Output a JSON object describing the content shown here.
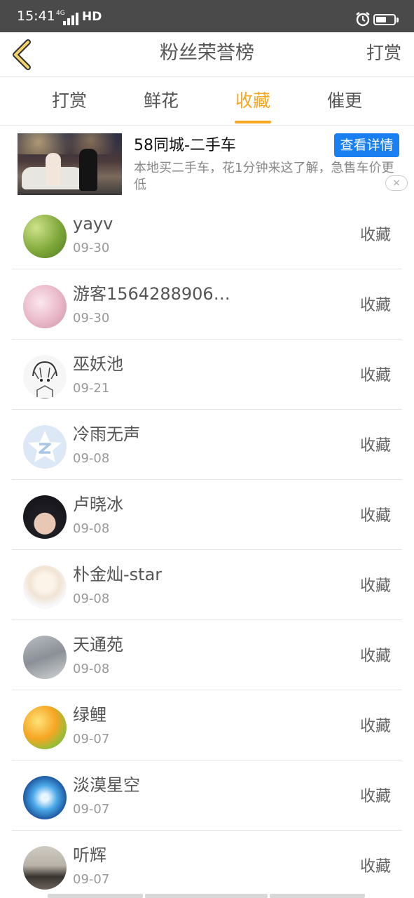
{
  "status_bar": {
    "time": "15:41",
    "network": "4G",
    "hd": "HD",
    "battery_level": 0.6
  },
  "header": {
    "title": "粉丝荣誉榜",
    "right_link": "打赏"
  },
  "tabs": [
    {
      "label": "打赏",
      "active": false
    },
    {
      "label": "鲜花",
      "active": false
    },
    {
      "label": "收藏",
      "active": true
    },
    {
      "label": "催更",
      "active": false
    }
  ],
  "ad": {
    "title": "58同城-二手车",
    "description": "本地买二手车，花1分钟来这了解，急售车价更低",
    "button_label": "查看详情",
    "close_icon": "×"
  },
  "fans": [
    {
      "name": "yayv",
      "date": "09-30",
      "action": "收藏",
      "avatar_icon": "green-leaves-avatar"
    },
    {
      "name": "游客1564288906…",
      "date": "09-30",
      "action": "收藏",
      "avatar_icon": "pink-blossom-avatar"
    },
    {
      "name": "巫妖池",
      "date": "09-21",
      "action": "收藏",
      "avatar_icon": "sketch-anime-avatar"
    },
    {
      "name": "冷雨无声",
      "date": "09-08",
      "action": "收藏",
      "avatar_icon": "default-qq-avatar"
    },
    {
      "name": "卢晓冰",
      "date": "09-08",
      "action": "收藏",
      "avatar_icon": "dark-hair-boy-avatar"
    },
    {
      "name": "朴金灿-star",
      "date": "09-08",
      "action": "收藏",
      "avatar_icon": "light-anime-girl-avatar"
    },
    {
      "name": "天通苑",
      "date": "09-08",
      "action": "收藏",
      "avatar_icon": "holding-hands-avatar"
    },
    {
      "name": "绿鲤",
      "date": "09-07",
      "action": "收藏",
      "avatar_icon": "autumn-painting-avatar"
    },
    {
      "name": "淡漠星空",
      "date": "09-07",
      "action": "收藏",
      "avatar_icon": "blue-starry-avatar"
    },
    {
      "name": "听辉",
      "date": "09-07",
      "action": "收藏",
      "avatar_icon": "girl-photo-avatar"
    }
  ],
  "colors": {
    "accent": "#f5a623",
    "ad_button": "#1a7ff0",
    "status_bar": "#4a4a4a"
  }
}
